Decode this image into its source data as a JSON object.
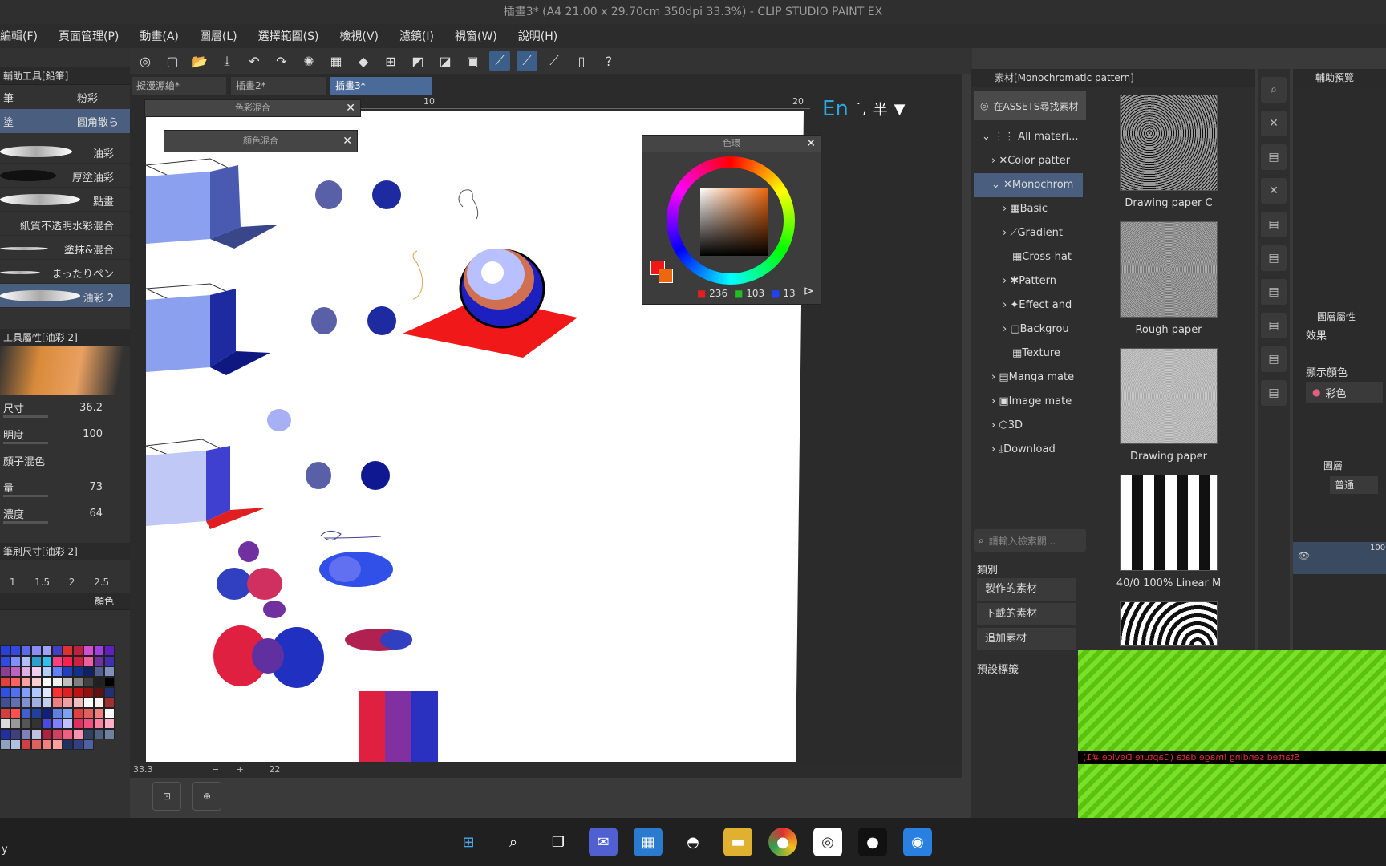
{
  "window": {
    "title": "插畫3* (A4 21.00 x 29.70cm 350dpi 33.3%) - CLIP STUDIO PAINT EX"
  },
  "menu": [
    "編輯(F)",
    "頁面管理(P)",
    "動畫(A)",
    "圖層(L)",
    "選擇範圍(S)",
    "檢視(V)",
    "濾鏡(I)",
    "視窗(W)",
    "說明(H)"
  ],
  "tabs": [
    {
      "label": "擬漫源繪*"
    },
    {
      "label": "插畫2*"
    },
    {
      "label": "插畫3*"
    }
  ],
  "subtool_panel": {
    "title": "輔助工具[鉛筆]",
    "row1": [
      "筆",
      "粉彩"
    ],
    "row2": [
      "塗",
      "圓角散ら"
    ],
    "brushes": [
      "油彩",
      "厚塗油彩",
      "點畫",
      "紙質不透明水彩混合",
      "塗抹&混合",
      "まったりペン",
      "油彩 2"
    ]
  },
  "tool_property": {
    "title": "工具屬性[油彩 2]",
    "props": [
      {
        "label": "尺寸",
        "value": "36.2"
      },
      {
        "label": "明度",
        "value": "100"
      },
      {
        "label": "顏子混色",
        "value": ""
      },
      {
        "label": "量",
        "value": "73"
      },
      {
        "label": "濃度",
        "value": "64"
      }
    ]
  },
  "brush_size": {
    "title": "筆刷尺寸[油彩 2]",
    "sizes": [
      "1",
      "1.5",
      "2",
      "2.5"
    ]
  },
  "palette_header": {
    "label": "顏色"
  },
  "palette_colors": [
    "#2a3fd8",
    "#3548e0",
    "#5a6af0",
    "#8c8cf5",
    "#a0a0ff",
    "#4040c0",
    "#e03030",
    "#c02040",
    "#d050d0",
    "#a040e0",
    "#6020c0",
    "#304ae0",
    "#7f8fff",
    "#b0c0ff",
    "#2a9fd0",
    "#30c0f0",
    "#ff4080",
    "#ff2050",
    "#d02040",
    "#f060a0",
    "#7030a0",
    "#4030b0",
    "#8a4090",
    "#c060c0",
    "#e0b0e0",
    "#f0d0f0",
    "#b0d0ff",
    "#6080ff",
    "#2040c0",
    "#103090",
    "#102060",
    "#506090",
    "#8090c0",
    "#e04040",
    "#ff6060",
    "#ffa0a0",
    "#ffd0d0",
    "#ffffff",
    "#f0f0f0",
    "#c0c0c0",
    "#808080",
    "#404040",
    "#202020",
    "#000000",
    "#3050e0",
    "#5070f0",
    "#80a0ff",
    "#b0c8ff",
    "#e0e8ff",
    "#ff3030",
    "#e02020",
    "#c01010",
    "#901010",
    "#601010",
    "#203070",
    "#405090",
    "#6070b0",
    "#8090d0",
    "#a0b0e0",
    "#c0d0f0",
    "#f08080",
    "#f0a0a0",
    "#f0c0c0",
    "#ffffff",
    "#fff0f0",
    "#a03030",
    "#d04040",
    "#ff5050",
    "#4060d0",
    "#2040a0",
    "#102080",
    "#6080e0",
    "#80a0f0",
    "#e04040",
    "#e06060",
    "#f08080",
    "#fff",
    "#ddd",
    "#999",
    "#555",
    "#333",
    "#4a4ae0",
    "#8080ff",
    "#c0c0ff",
    "#e03060",
    "#f05080",
    "#ff80a0",
    "#ffb0c8",
    "#2030a0",
    "#404080",
    "#8080c0",
    "#c0c0e0",
    "#b02040",
    "#d04060",
    "#f06080",
    "#ff90b0",
    "#304060",
    "#506080",
    "#7080a0",
    "#90a0c0",
    "#b0c0e0",
    "#d04040",
    "#e06060",
    "#f08080",
    "#ffa0a0",
    "#203060",
    "#304080",
    "#5060a0"
  ],
  "canvas": {
    "ruler": {
      "mark10": "10",
      "mark20": "20"
    },
    "ime": {
      "lang": "En",
      "punct": "˙,",
      "half": "半"
    }
  },
  "palette_panel_1": {
    "title": "色彩混合"
  },
  "palette_panel_2": {
    "title": "顏色混合"
  },
  "color_wheel": {
    "title": "色環",
    "rgb": {
      "r": "236",
      "g": "103",
      "b": "13"
    }
  },
  "status": {
    "zoom": "33.3",
    "rotate": "22"
  },
  "materials": {
    "header": "素材[Monochromatic pattern]",
    "search_assets": "在ASSETS尋找素材",
    "tree": [
      "All materi...",
      "Color patter",
      "Monochrom",
      "Basic",
      "Gradient",
      "Cross-hat",
      "Pattern",
      "Effect and",
      "Backgrou",
      "Texture",
      "Manga mate",
      "Image mate",
      "3D",
      "Download"
    ],
    "thumbs": [
      "Drawing paper C",
      "Rough paper",
      "Drawing paper",
      "40/0 100% Linear M"
    ],
    "search_placeholder": "請輸入檢索關...",
    "category_label": "類別",
    "categories": [
      "製作的素材",
      "下載的素材",
      "追加素材"
    ],
    "tags_label": "預設標籤"
  },
  "right_panel": {
    "nav_title": "輔助預覽",
    "layer_prop_title": "圖層屬性",
    "effect_label": "效果",
    "display_color_label": "顯示顏色",
    "display_color_value": "彩色",
    "layer_title": "圖層",
    "layer_mode": "普通",
    "layer_opacity": "100"
  },
  "capture_overlay": {
    "message": "Started sending image data (Capture Device #1)"
  },
  "corner_text": "y"
}
